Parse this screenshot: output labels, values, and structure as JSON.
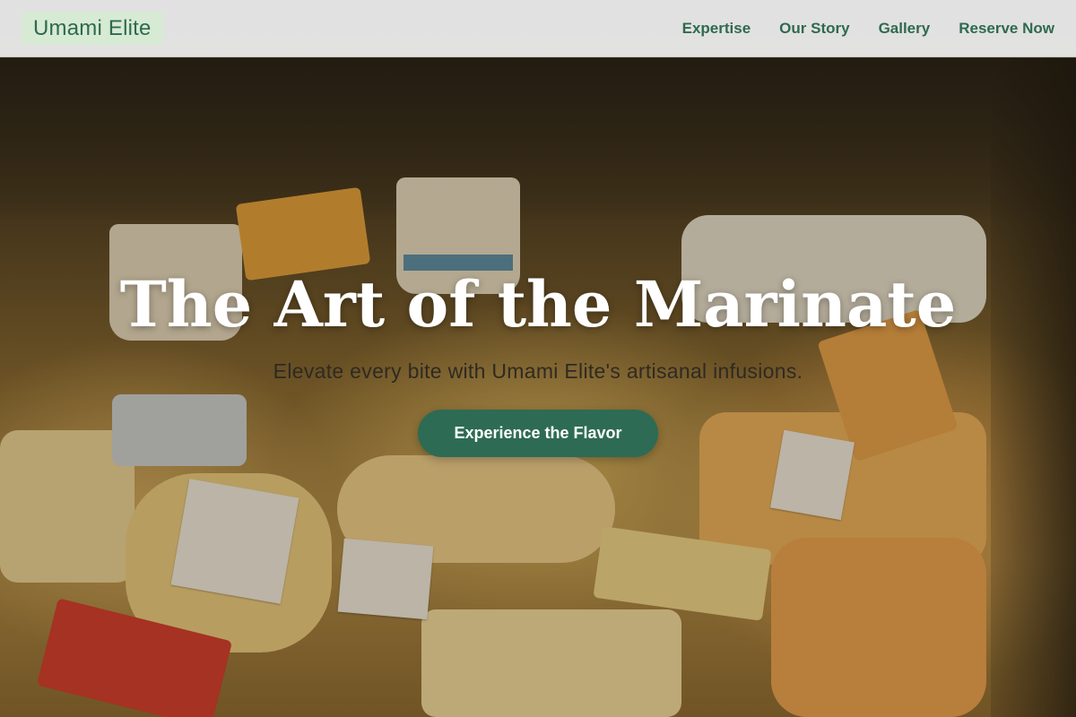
{
  "header": {
    "logo": "Umami Elite",
    "nav": [
      {
        "label": "Expertise"
      },
      {
        "label": "Our Story"
      },
      {
        "label": "Gallery"
      },
      {
        "label": "Reserve Now"
      }
    ]
  },
  "hero": {
    "title": "The Art of the Marinate",
    "subtitle": "Elevate every bite with Umami Elite's artisanal infusions.",
    "cta_label": "Experience the Flavor"
  },
  "colors": {
    "brand_green": "#2d6b55",
    "logo_bg": "#d7ead4",
    "header_bg": "#ececec"
  }
}
